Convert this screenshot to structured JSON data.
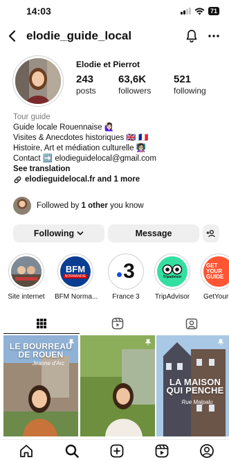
{
  "status_bar": {
    "time": "14:03",
    "battery": "71"
  },
  "header": {
    "username": "elodie_guide_local"
  },
  "profile": {
    "display_name": "Elodie et Pierrot",
    "stats": [
      {
        "value": "243",
        "label": "posts"
      },
      {
        "value": "63,6K",
        "label": "followers"
      },
      {
        "value": "521",
        "label": "following"
      }
    ]
  },
  "bio": {
    "category": "Tour guide",
    "lines": [
      "Guide locale Rouennaise 🙋🏻‍♀️",
      "Visites & Anecdotes historiques 🇬🇧 🇫🇷",
      "Histoire, Art et médiation culturelle 👩🏻‍🏫",
      "Contact ➡️ elodieguidelocal@gmail.com"
    ],
    "see_translation": "See translation",
    "link": "elodieguidelocal.fr and 1 more"
  },
  "followed_by": {
    "prefix": "Followed by ",
    "bold": "1 other",
    "suffix": " you know"
  },
  "actions": {
    "following": "Following",
    "message": "Message"
  },
  "highlights": [
    {
      "label": "Site internet",
      "icon": "website-highlight",
      "text": "",
      "bg": "#6b6b6b"
    },
    {
      "label": "BFM Norma...",
      "icon": "bfm-logo",
      "text": "BFM",
      "sub": "NORMANDIE",
      "bg": "#0a3d91"
    },
    {
      "label": "France 3",
      "icon": "france3-logo",
      "text": "3",
      "bg": "#ffffff"
    },
    {
      "label": "TripAdvisor",
      "icon": "tripadvisor-logo",
      "text": "Tripadvisor",
      "bg": "#34e0a1"
    },
    {
      "label": "GetYourG",
      "icon": "getyourguide-logo",
      "text": "GET YOUR GUIDE",
      "bg": "#ff5533"
    }
  ],
  "posts": [
    {
      "title": "LE BOURREAU DE ROUEN",
      "sub": "Jeanne d'Arc"
    },
    {
      "title": "",
      "sub": ""
    },
    {
      "title": "LA MAISON QUI PENCHE",
      "sub": "Rue Malpalu"
    }
  ],
  "colors": {
    "accent": "#0095f6",
    "button_bg": "#efefef",
    "text": "#111111"
  }
}
